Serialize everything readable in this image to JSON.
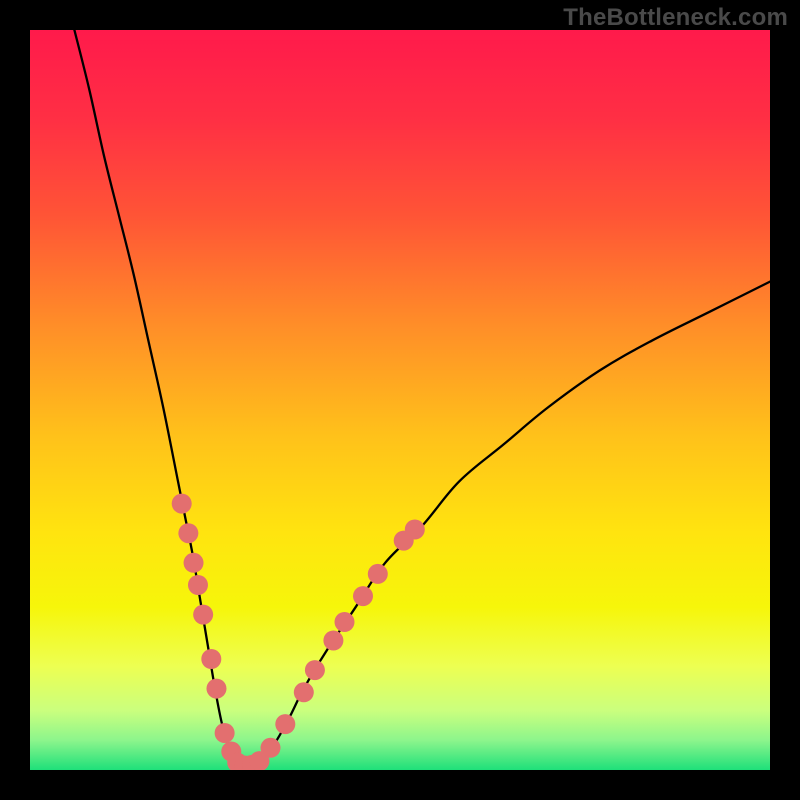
{
  "watermark": "TheBottleneck.com",
  "chart_data": {
    "type": "line",
    "title": "",
    "xlabel": "",
    "ylabel": "",
    "xlim": [
      0,
      100
    ],
    "ylim": [
      0,
      100
    ],
    "grid": false,
    "legend": "none",
    "background": {
      "kind": "vertical-gradient",
      "stops": [
        {
          "offset": 0.0,
          "color": "#ff1a4b"
        },
        {
          "offset": 0.12,
          "color": "#ff2f44"
        },
        {
          "offset": 0.25,
          "color": "#ff5436"
        },
        {
          "offset": 0.4,
          "color": "#ff8e28"
        },
        {
          "offset": 0.55,
          "color": "#ffc21a"
        },
        {
          "offset": 0.68,
          "color": "#ffe40f"
        },
        {
          "offset": 0.78,
          "color": "#f6f60a"
        },
        {
          "offset": 0.86,
          "color": "#edff52"
        },
        {
          "offset": 0.92,
          "color": "#caff7e"
        },
        {
          "offset": 0.96,
          "color": "#8cf58c"
        },
        {
          "offset": 1.0,
          "color": "#1ee07a"
        }
      ]
    },
    "series": [
      {
        "name": "bottleneck-curve",
        "color": "#000000",
        "stroke_width": 2.3,
        "x": [
          6,
          8,
          10,
          12,
          14,
          16,
          18,
          20,
          21,
          22,
          23,
          24,
          25,
          26,
          27,
          28,
          29,
          30,
          31,
          33,
          35,
          37,
          40,
          44,
          48,
          53,
          58,
          64,
          70,
          77,
          84,
          92,
          100
        ],
        "y": [
          100,
          92,
          83,
          75,
          67,
          58,
          49,
          39,
          34,
          29,
          23,
          17,
          11,
          6,
          3,
          1.2,
          0.6,
          0.6,
          1.2,
          3.5,
          7,
          11,
          16,
          22,
          28,
          33,
          39,
          44,
          49,
          54,
          58,
          62,
          66
        ]
      }
    ],
    "markers": {
      "name": "highlighted-points",
      "color": "#e36f6f",
      "radius": 10,
      "points": [
        {
          "x": 20.5,
          "y": 36
        },
        {
          "x": 21.4,
          "y": 32
        },
        {
          "x": 22.1,
          "y": 28
        },
        {
          "x": 22.7,
          "y": 25
        },
        {
          "x": 23.4,
          "y": 21
        },
        {
          "x": 24.5,
          "y": 15
        },
        {
          "x": 25.2,
          "y": 11
        },
        {
          "x": 26.3,
          "y": 5
        },
        {
          "x": 27.2,
          "y": 2.5
        },
        {
          "x": 28.0,
          "y": 1.0
        },
        {
          "x": 29.0,
          "y": 0.6
        },
        {
          "x": 30.0,
          "y": 0.7
        },
        {
          "x": 31.0,
          "y": 1.2
        },
        {
          "x": 32.5,
          "y": 3.0
        },
        {
          "x": 34.5,
          "y": 6.2
        },
        {
          "x": 37.0,
          "y": 10.5
        },
        {
          "x": 38.5,
          "y": 13.5
        },
        {
          "x": 41.0,
          "y": 17.5
        },
        {
          "x": 42.5,
          "y": 20.0
        },
        {
          "x": 45.0,
          "y": 23.5
        },
        {
          "x": 47.0,
          "y": 26.5
        },
        {
          "x": 50.5,
          "y": 31.0
        },
        {
          "x": 52.0,
          "y": 32.5
        }
      ]
    }
  }
}
